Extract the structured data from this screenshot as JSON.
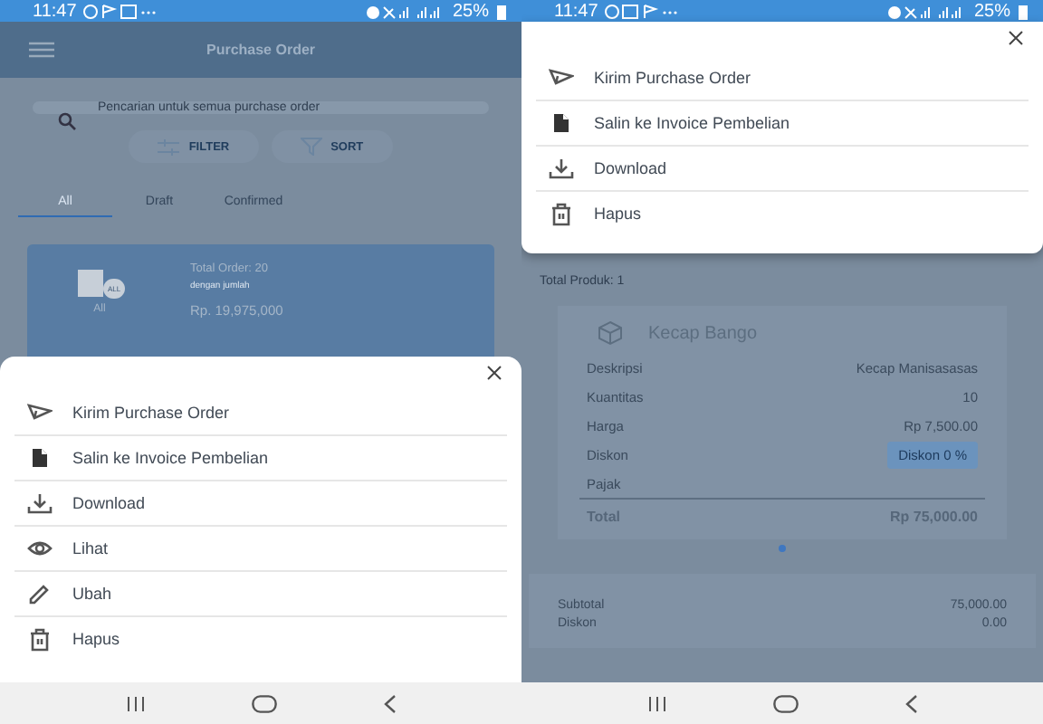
{
  "left_screen": {
    "status_bar": {
      "time": "11:47",
      "battery": "25%"
    },
    "app_bar": {
      "title": "Purchase Order"
    },
    "search": {
      "placeholder": "Pencarian untuk semua purchase order"
    },
    "buttons": [
      {
        "label": "FILTER",
        "kind": "filter"
      },
      {
        "label": "SORT",
        "kind": "sort"
      }
    ],
    "tabs": [
      {
        "label": "All",
        "selected": true
      },
      {
        "label": "Draft",
        "selected": false
      },
      {
        "label": "Confirmed",
        "selected": false
      }
    ],
    "summary_card": {
      "badge": "ALL",
      "label": "All",
      "title": "Total Order: 20",
      "subtitle": "dengan jumlah",
      "amount": "Rp. 19,975,000"
    },
    "action_sheet": {
      "items": [
        {
          "label": "Kirim Purchase Order",
          "kind": "send"
        },
        {
          "label": "Salin ke Invoice Pembelian",
          "kind": "copy"
        },
        {
          "label": "Download",
          "kind": "download"
        },
        {
          "label": "Lihat",
          "kind": "view"
        },
        {
          "label": "Ubah",
          "kind": "edit"
        },
        {
          "label": "Hapus",
          "kind": "delete"
        }
      ]
    }
  },
  "right_screen": {
    "status_bar": {
      "time": "11:47",
      "battery": "25%"
    },
    "action_sheet": {
      "items": [
        {
          "label": "Kirim Purchase Order",
          "kind": "send"
        },
        {
          "label": "Salin ke Invoice Pembelian",
          "kind": "copy"
        },
        {
          "label": "Download",
          "kind": "download"
        },
        {
          "label": "Hapus",
          "kind": "delete"
        }
      ]
    },
    "total_products": "Total Produk: 1",
    "product": {
      "name": "Kecap Bango",
      "rows": [
        {
          "label": "Deskripsi",
          "value": "Kecap Manisasasas",
          "kind": "text"
        },
        {
          "label": "Kuantitas",
          "value": "10",
          "kind": "text"
        },
        {
          "label": "Harga",
          "value": "Rp 7,500.00",
          "kind": "text"
        },
        {
          "label": "Diskon",
          "value": "Diskon 0 %",
          "kind": "badge"
        },
        {
          "label": "Pajak"
        }
      ],
      "total_label": "Total",
      "total_value": "Rp 75,000.00"
    },
    "pager": [
      {
        "selected": true
      }
    ],
    "summary": [
      {
        "label": "Subtotal",
        "value": "75,000.00"
      },
      {
        "label": "Diskon",
        "value": "0.00"
      }
    ]
  }
}
